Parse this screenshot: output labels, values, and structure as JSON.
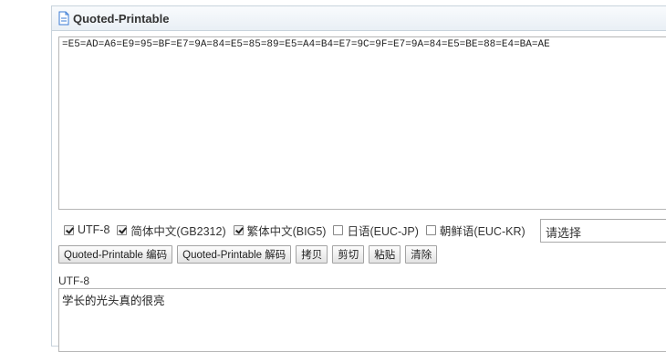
{
  "panel": {
    "title": "Quoted-Printable"
  },
  "input": {
    "value": "=E5=AD=A6=E9=95=BF=E7=9A=84=E5=85=89=E5=A4=B4=E7=9C=9F=E7=9A=84=E5=BE=88=E4=BA=AE"
  },
  "options": [
    {
      "label": "UTF-8",
      "checked": true
    },
    {
      "label": "简体中文(GB2312)",
      "checked": true
    },
    {
      "label": "繁体中文(BIG5)",
      "checked": true
    },
    {
      "label": "日语(EUC-JP)",
      "checked": false
    },
    {
      "label": "朝鲜语(EUC-KR)",
      "checked": false
    }
  ],
  "select": {
    "value": "请选择"
  },
  "buttons": {
    "encode": "Quoted-Printable 编码",
    "decode": "Quoted-Printable 解码",
    "copy": "拷贝",
    "cut": "剪切",
    "paste": "粘贴",
    "clear": "清除"
  },
  "output": {
    "label": "UTF-8",
    "value": "学长的光头真的很亮"
  }
}
